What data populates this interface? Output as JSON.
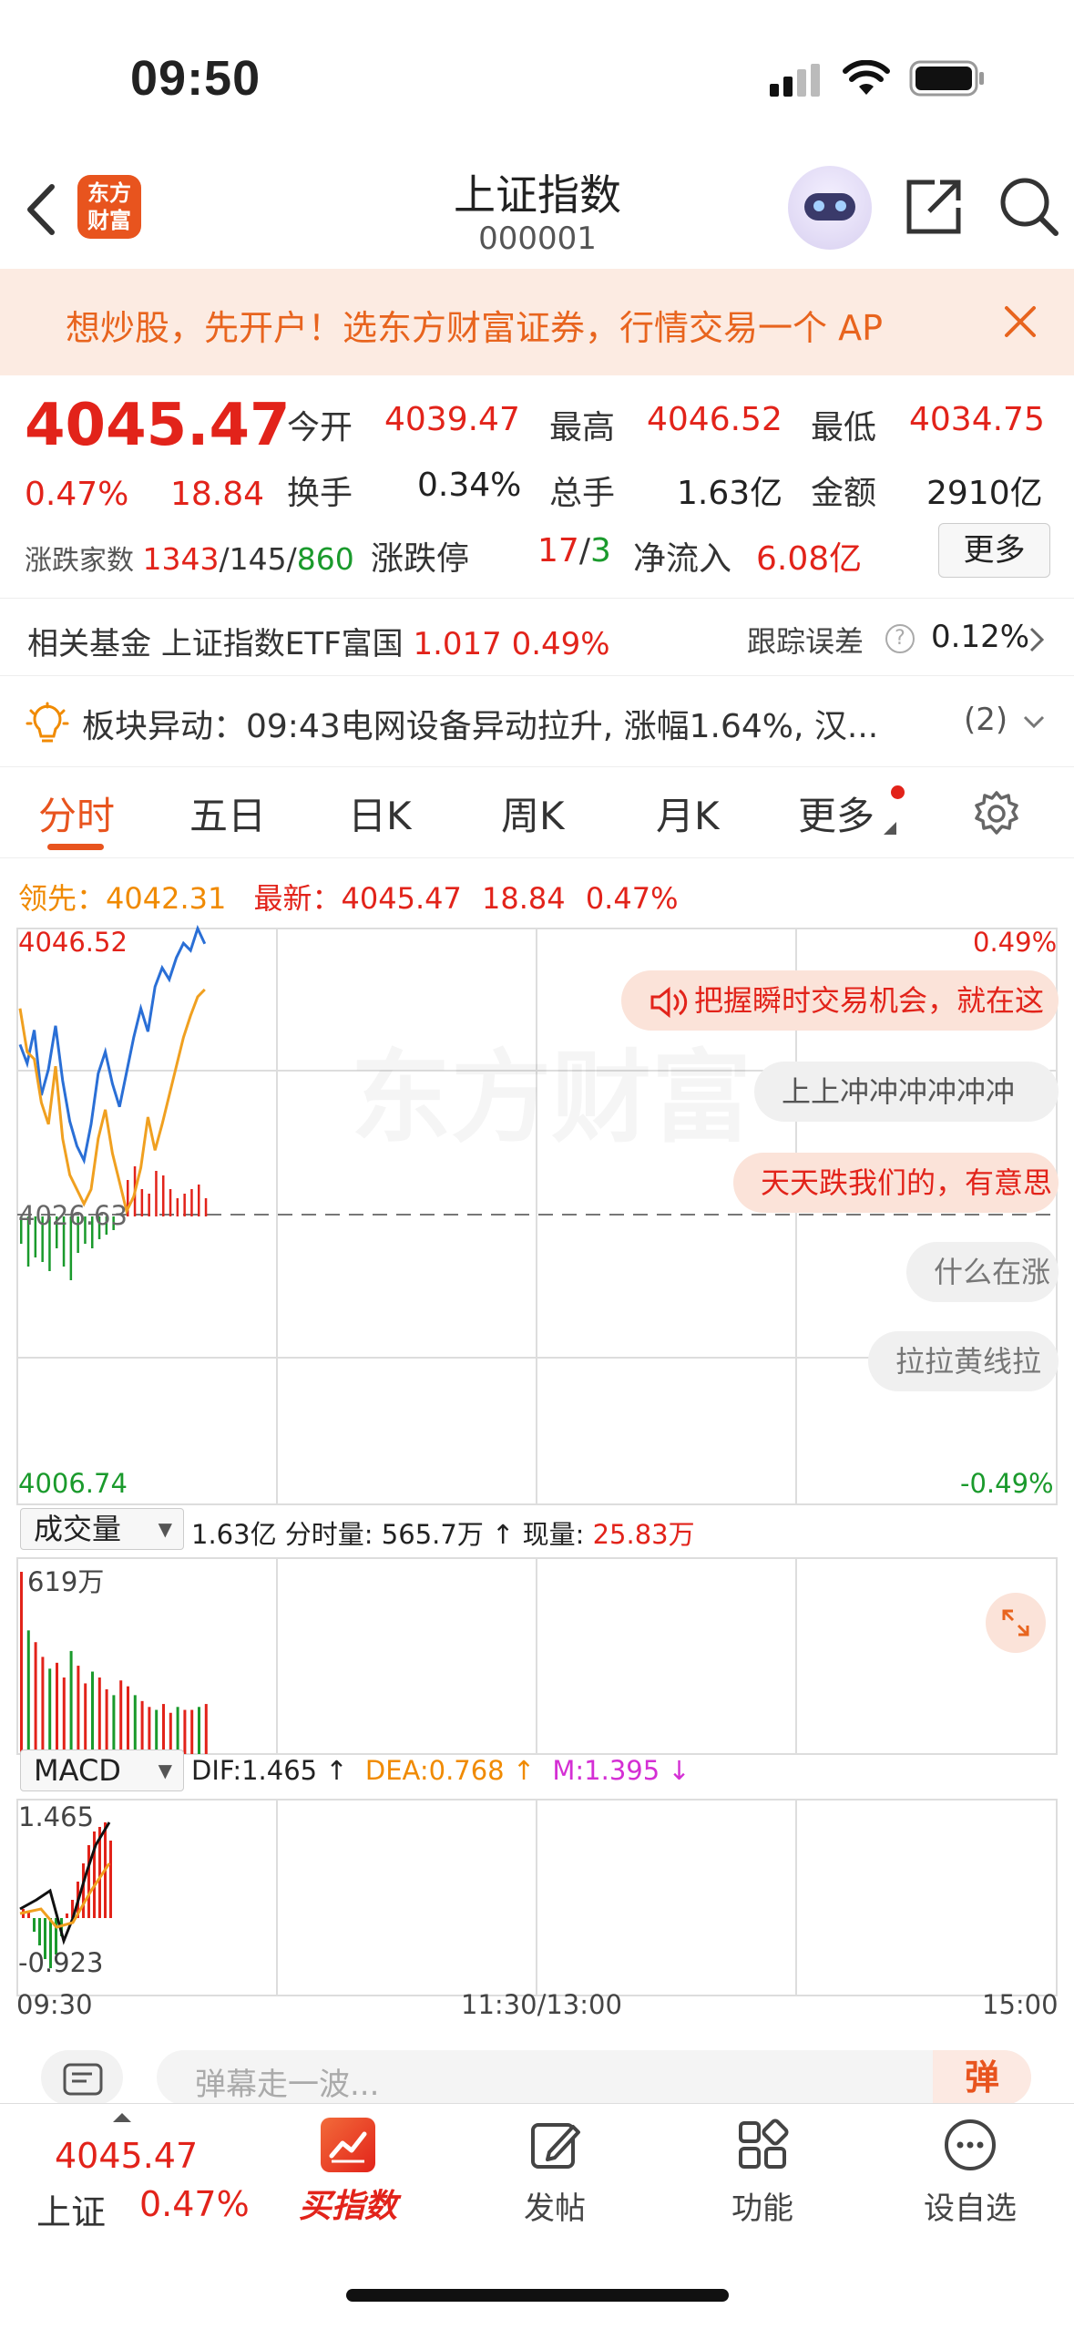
{
  "status": {
    "time": "09:50"
  },
  "nav": {
    "title": "上证指数",
    "code": "000001",
    "logo_top": "东方",
    "logo_bottom": "财富"
  },
  "banner": {
    "text": "想炒股，先开户！选东方财富证券，行情交易一个 AP"
  },
  "quote": {
    "price": "4045.47",
    "pct": "0.47%",
    "change": "18.84",
    "open_label": "今开",
    "open": "4039.47",
    "high_label": "最高",
    "high": "4046.52",
    "low_label": "最低",
    "low": "4034.75",
    "turnover_label": "换手",
    "turnover": "0.34%",
    "volume_label": "总手",
    "volume": "1.63亿",
    "amount_label": "金额",
    "amount": "2910亿",
    "breadth_label": "涨跌家数",
    "up": "1343",
    "flat": "145",
    "down": "860",
    "limit_label": "涨跌停",
    "limit_up": "17",
    "limit_down": "3",
    "netflow_label": "净流入",
    "netflow": "6.08亿",
    "more_label": "更多"
  },
  "fund": {
    "label": "相关基金",
    "name": "上证指数ETF富国",
    "price": "1.017",
    "pct": "0.49%",
    "track_label": "跟踪误差",
    "track_value": "0.12%"
  },
  "sector": {
    "text": "板块异动：09:43电网设备异动拉升, 涨幅1.64%, 汉...",
    "count": "(2)"
  },
  "tabs": [
    "分时",
    "五日",
    "日K",
    "周K",
    "月K",
    "更多"
  ],
  "chart_info": {
    "lead_label": "领先：",
    "lead": "4042.31",
    "latest_label": "最新：",
    "latest": "4045.47",
    "change": "18.84",
    "pct": "0.47%"
  },
  "chart": {
    "y_max": "4046.52",
    "y_mid": "4026.63",
    "y_min": "4006.74",
    "pct_max": "0.49%",
    "pct_min": "-0.49%",
    "watermark": "东方财富",
    "bubbles": [
      "把握瞬时交易机会，就在这",
      "上上冲冲冲冲冲冲",
      "天天跌我们的，有意思",
      "什么在涨",
      "拉拉黄线拉"
    ],
    "vol_label": "成交量",
    "vol_total": "1.63亿",
    "vol_period_label": "分时量:",
    "vol_period": "565.7万",
    "vol_now_label": "现量:",
    "vol_now": "25.83万",
    "vol_max": "619万",
    "macd_label": "MACD",
    "dif": "DIF:1.465",
    "dea": "DEA:0.768",
    "m": "M:1.395",
    "macd_max": "1.465",
    "macd_min": "-0.923",
    "time_start": "09:30",
    "time_mid": "11:30/13:00",
    "time_end": "15:00"
  },
  "chart_data": {
    "type": "line",
    "series": [
      {
        "name": "最新",
        "color": "#2a6fd6",
        "values": [
          4038.5,
          4037.2,
          4039.5,
          4035.0,
          4036.8,
          4039.8,
          4036.0,
          4033.2,
          4031.5,
          4030.5,
          4033.0,
          4036.5,
          4038.0,
          4035.8,
          4034.2,
          4036.6,
          4039.0,
          4041.0,
          4039.4,
          4042.5,
          4043.8,
          4043.0,
          4044.5,
          4045.5,
          4045.0,
          4046.52,
          4045.47
        ]
      },
      {
        "name": "领先",
        "color": "#f0a020",
        "values": [
          4041.0,
          4038.0,
          4037.5,
          4034.5,
          4033.0,
          4037.0,
          4032.0,
          4029.5,
          4028.5,
          4027.5,
          4028.5,
          4032.0,
          4034.0,
          4031.0,
          4029.0,
          4027.0,
          4028.0,
          4030.0,
          4033.5,
          4031.2,
          4033.0,
          4035.0,
          4037.0,
          4039.0,
          4040.5,
          4041.8,
          4042.31
        ]
      }
    ],
    "ylim": [
      4006.74,
      4046.52
    ],
    "baseline": 4026.63,
    "volume_bars": [
      619,
      420,
      380,
      330,
      290,
      310,
      260,
      350,
      300,
      240,
      280,
      260,
      220,
      200,
      250,
      230,
      200,
      180,
      160,
      150,
      170,
      140,
      160,
      150,
      150,
      160,
      170
    ]
  },
  "input": {
    "placeholder": "弹幕走一波...",
    "send": "弹"
  },
  "tabbar": {
    "index_price": "4045.47",
    "index_name": "上证",
    "index_pct": "0.47%",
    "buy": "买指数",
    "post": "发帖",
    "func": "功能",
    "watch": "设自选"
  }
}
